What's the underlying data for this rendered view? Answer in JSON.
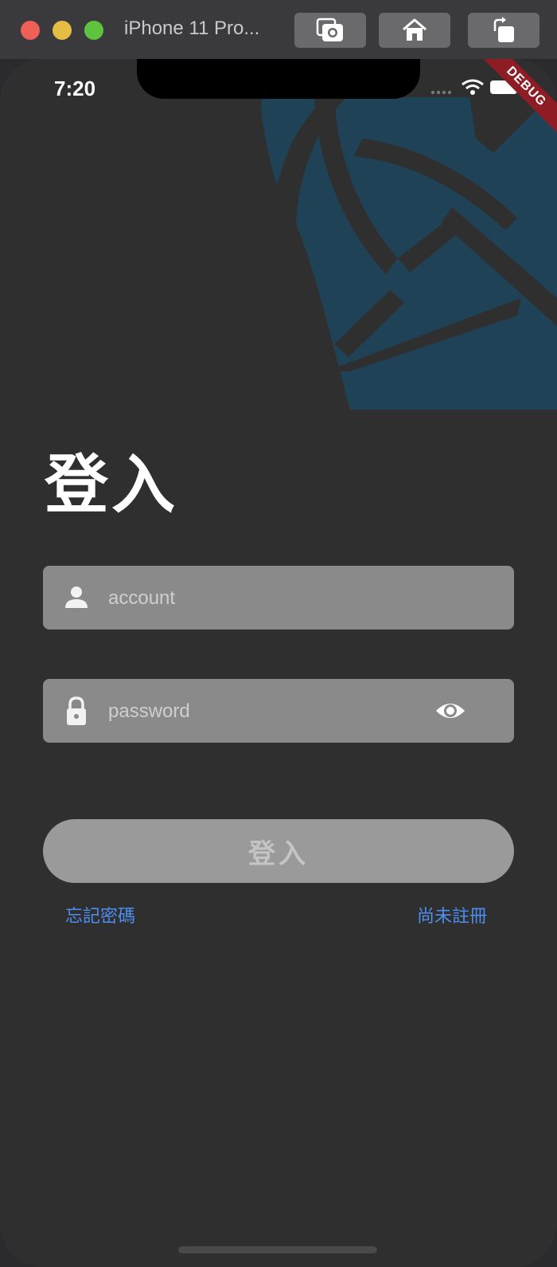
{
  "window": {
    "title": "iPhone 11 Pro...",
    "buttons": [
      "screenshot-icon",
      "home-icon",
      "rotate-icon"
    ]
  },
  "status_bar": {
    "time": "7:20"
  },
  "debug_banner": "DEBUG",
  "login": {
    "title": "登入",
    "account_placeholder": "account",
    "password_placeholder": "password",
    "submit_label": "登入",
    "forgot_password": "忘記密碼",
    "register": "尚未註冊"
  },
  "colors": {
    "background": "#2f2f30",
    "art_accent": "#1f4256",
    "field_bg": "#8a8a8a",
    "button_bg": "#9a9a9a",
    "link": "#4d8ef0",
    "debug_ribbon": "#8e1c25"
  }
}
